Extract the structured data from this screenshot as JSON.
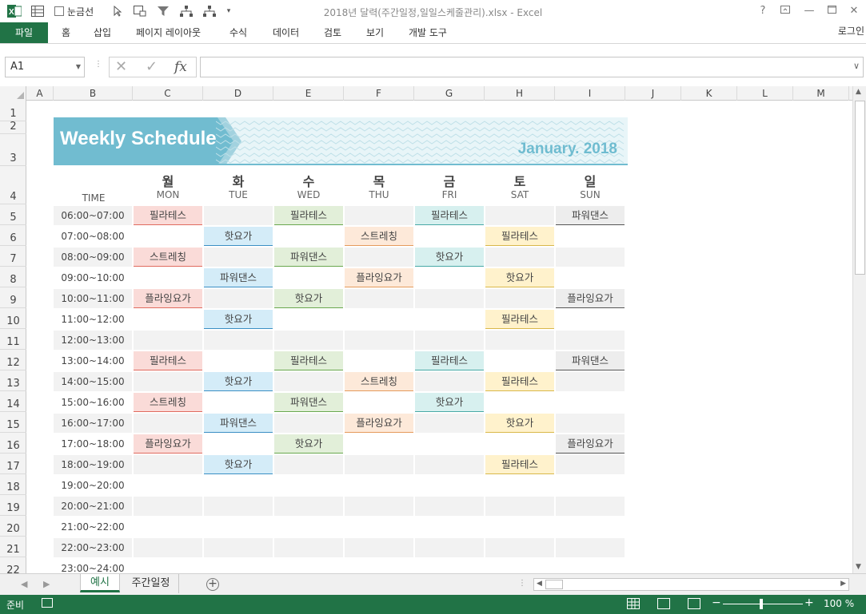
{
  "window": {
    "title": "2018년 달력(주간일정,일일스케줄관리).xlsx - Excel"
  },
  "quick_access": {
    "gridlines_label": "눈금선"
  },
  "ribbon": {
    "tabs": [
      "파일",
      "홈",
      "삽입",
      "페이지 레이아웃",
      "수식",
      "데이터",
      "검토",
      "보기",
      "개발 도구"
    ],
    "login": "로그인"
  },
  "formula_bar": {
    "name_box": "A1",
    "fx": "fx",
    "formula": ""
  },
  "columns": [
    "A",
    "B",
    "C",
    "D",
    "E",
    "F",
    "G",
    "H",
    "I",
    "J",
    "K",
    "L",
    "M"
  ],
  "rows": [
    "1",
    "2",
    "3",
    "4",
    "5",
    "6",
    "7",
    "8",
    "9",
    "10",
    "11",
    "12",
    "13",
    "14",
    "15",
    "16",
    "17",
    "18",
    "19",
    "20",
    "21",
    "22"
  ],
  "schedule": {
    "title": "Weekly Schedule",
    "month": "January. 2018",
    "time_header": "TIME",
    "days": [
      {
        "ko": "월",
        "en": "MON"
      },
      {
        "ko": "화",
        "en": "TUE"
      },
      {
        "ko": "수",
        "en": "WED"
      },
      {
        "ko": "목",
        "en": "THU"
      },
      {
        "ko": "금",
        "en": "FRI"
      },
      {
        "ko": "토",
        "en": "SAT"
      },
      {
        "ko": "일",
        "en": "SUN"
      }
    ],
    "times": [
      "06:00~07:00",
      "07:00~08:00",
      "08:00~09:00",
      "09:00~10:00",
      "10:00~11:00",
      "11:00~12:00",
      "12:00~13:00",
      "13:00~14:00",
      "14:00~15:00",
      "15:00~16:00",
      "16:00~17:00",
      "17:00~18:00",
      "18:00~19:00",
      "19:00~20:00",
      "20:00~21:00",
      "21:00~22:00",
      "22:00~23:00",
      "23:00~24:00"
    ],
    "grid": [
      [
        "필라테스",
        "",
        "필라테스",
        "",
        "필라테스",
        "",
        "파워댄스"
      ],
      [
        "",
        "핫요가",
        "",
        "스트레칭",
        "",
        "필라테스",
        ""
      ],
      [
        "스트레칭",
        "",
        "파워댄스",
        "",
        "핫요가",
        "",
        ""
      ],
      [
        "",
        "파워댄스",
        "",
        "플라잉요가",
        "",
        "핫요가",
        ""
      ],
      [
        "플라잉요가",
        "",
        "핫요가",
        "",
        "",
        "",
        "플라잉요가"
      ],
      [
        "",
        "핫요가",
        "",
        "",
        "",
        "필라테스",
        ""
      ],
      [
        "",
        "",
        "",
        "",
        "",
        "",
        ""
      ],
      [
        "필라테스",
        "",
        "필라테스",
        "",
        "필라테스",
        "",
        "파워댄스"
      ],
      [
        "",
        "핫요가",
        "",
        "스트레칭",
        "",
        "필라테스",
        ""
      ],
      [
        "스트레칭",
        "",
        "파워댄스",
        "",
        "핫요가",
        "",
        ""
      ],
      [
        "",
        "파워댄스",
        "",
        "플라잉요가",
        "",
        "핫요가",
        ""
      ],
      [
        "플라잉요가",
        "",
        "핫요가",
        "",
        "",
        "",
        "플라잉요가"
      ],
      [
        "",
        "핫요가",
        "",
        "",
        "",
        "필라테스",
        ""
      ],
      [
        "",
        "",
        "",
        "",
        "",
        "",
        ""
      ],
      [
        "",
        "",
        "",
        "",
        "",
        "",
        ""
      ],
      [
        "",
        "",
        "",
        "",
        "",
        "",
        ""
      ],
      [
        "",
        "",
        "",
        "",
        "",
        "",
        ""
      ],
      [
        "",
        "",
        "",
        "",
        "",
        "",
        ""
      ]
    ],
    "day_colors": [
      {
        "bg": "#fadbd8",
        "line": "#e06b5f"
      },
      {
        "bg": "#d4ecf8",
        "line": "#3b8fc4"
      },
      {
        "bg": "#e2efd9",
        "line": "#6aa84f"
      },
      {
        "bg": "#fde9d9",
        "line": "#e59b5c"
      },
      {
        "bg": "#d7f0ef",
        "line": "#48a9a6"
      },
      {
        "bg": "#fff2cc",
        "line": "#d9b84a"
      },
      {
        "bg": "#ededed",
        "line": "#555555"
      }
    ]
  },
  "sheets": {
    "active": "예시",
    "other": "주간일정"
  },
  "status": {
    "ready": "준비",
    "zoom": "100 %"
  }
}
